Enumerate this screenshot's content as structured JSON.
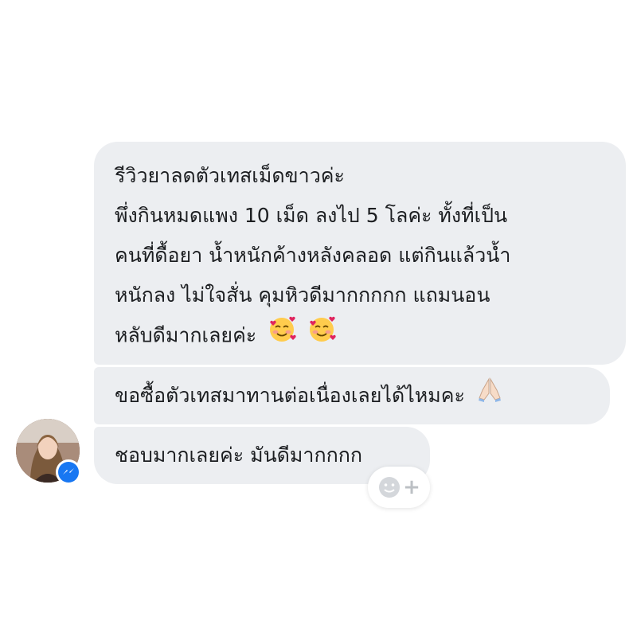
{
  "messages": [
    {
      "lines": [
        "รีวิวยาลดตัวเทสเม็ดขาวค่ะ",
        "พึ่งกินหมดแพง 10 เม็ด ลงไป 5 โลค่ะ ทั้งที่เป็น",
        "คนที่ดื้อยา น้ำหนักค้างหลังคลอด แต่กินแล้วน้ำ",
        "หนักลง ไม่ใจสั่น คุมหิวดีมากกกกก แถมนอน",
        "หลับดีมากเลยค่ะ"
      ],
      "trailing_emoji": [
        "smiling-face-with-hearts",
        "smiling-face-with-hearts"
      ]
    },
    {
      "text": "ขอซื้อตัวเทสมาทานต่อเนื่องเลยได้ไหมคะ",
      "trailing_emoji": [
        "folded-hands"
      ]
    },
    {
      "text": "ชอบมากเลยค่ะ มันดีมากกกก"
    }
  ],
  "sender": {
    "avatar": "profile-photo",
    "badge_icon": "messenger-icon"
  },
  "reaction_button": {
    "icons": [
      "smiley-icon",
      "plus-icon"
    ],
    "plus_glyph": "+"
  },
  "colors": {
    "bubble_bg": "#eceef1",
    "text": "#1c1e21",
    "messenger_blue": "#1877f2",
    "reaction_icon": "#bcc0c4"
  }
}
